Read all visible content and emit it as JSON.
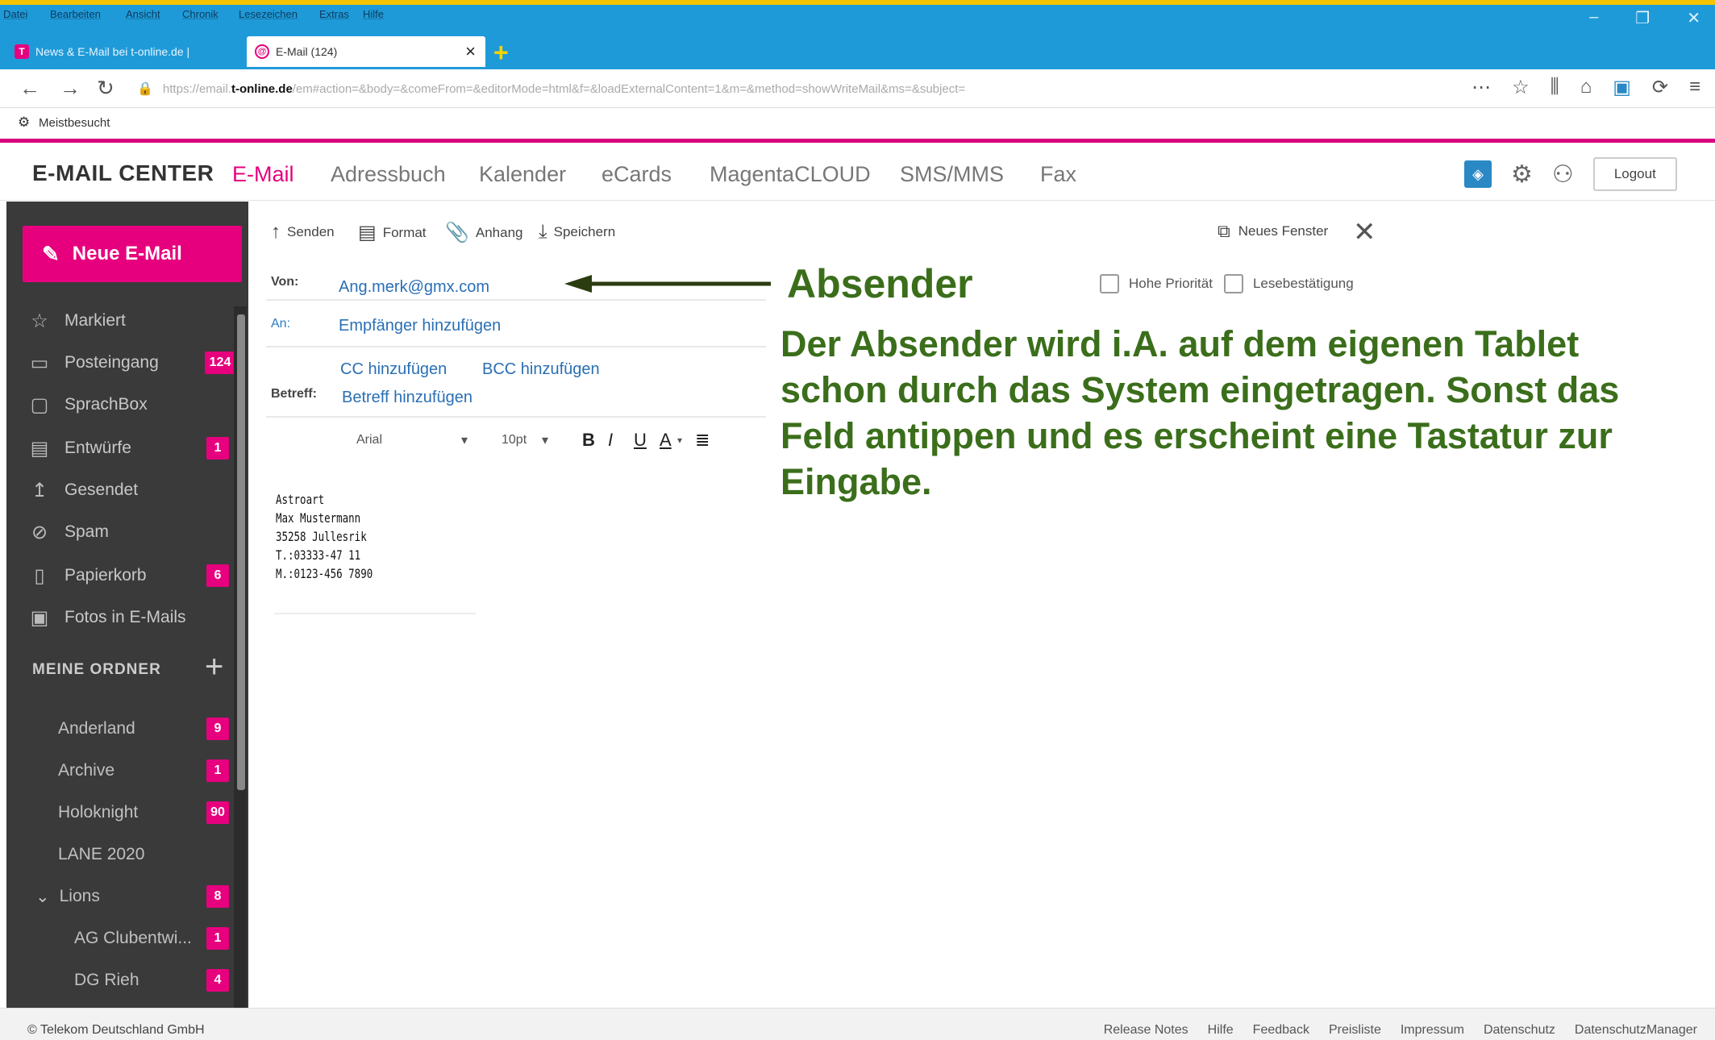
{
  "browser": {
    "menu": [
      "Datei",
      "Bearbeiten",
      "Ansicht",
      "Chronik",
      "Lesezeichen",
      "Extras",
      "Hilfe"
    ],
    "tabs": [
      {
        "title": "News & E-Mail bei t-online.de | ",
        "favicon": "T"
      },
      {
        "title": "E-Mail (124)",
        "favicon": "@"
      }
    ],
    "url_prefix": "https://email.",
    "url_domain": "t-online.de",
    "url_rest": "/em#action=&body=&comeFrom=&editorMode=html&f=&loadExternalContent=1&m=&method=showWriteMail&ms=&subject=",
    "bookmark": "Meistbesucht"
  },
  "app": {
    "brand": "E-MAIL CENTER",
    "nav": [
      "E-Mail",
      "Adressbuch",
      "Kalender",
      "eCards",
      "MagentaCLOUD",
      "SMS/MMS",
      "Fax"
    ],
    "logout": "Logout",
    "accent": "#e6007e"
  },
  "sidebar": {
    "new_mail": "Neue E-Mail",
    "items": [
      {
        "label": "Markiert",
        "icon": "star-icon",
        "badge": ""
      },
      {
        "label": "Posteingang",
        "icon": "inbox-icon",
        "badge": "124"
      },
      {
        "label": "SprachBox",
        "icon": "voicebox-icon",
        "badge": ""
      },
      {
        "label": "Entwürfe",
        "icon": "draft-icon",
        "badge": "1"
      },
      {
        "label": "Gesendet",
        "icon": "sent-icon",
        "badge": ""
      },
      {
        "label": "Spam",
        "icon": "spam-icon",
        "badge": ""
      },
      {
        "label": "Papierkorb",
        "icon": "trash-icon",
        "badge": "6"
      },
      {
        "label": "Fotos in E-Mails",
        "icon": "photo-icon",
        "badge": ""
      }
    ],
    "folders_title": "MEINE ORDNER",
    "folders": [
      {
        "label": "Anderland",
        "badge": "9"
      },
      {
        "label": "Archive",
        "badge": "1"
      },
      {
        "label": "Holoknight",
        "badge": "90"
      },
      {
        "label": "LANE 2020",
        "badge": ""
      },
      {
        "label": "Lions",
        "badge": "8"
      },
      {
        "label": "AG Clubentwi...",
        "badge": "1"
      },
      {
        "label": "DG Rieh",
        "badge": "4"
      }
    ]
  },
  "compose": {
    "toolbar": {
      "send": "Senden",
      "format": "Format",
      "attach": "Anhang",
      "save": "Speichern",
      "new_window": "Neues Fenster"
    },
    "from_label": "Von:",
    "from_value": "Ang.merk@gmx.com",
    "to_label": "An:",
    "to_placeholder": "Empfänger hinzufügen",
    "cc": "CC hinzufügen",
    "bcc": "BCC hinzufügen",
    "subject_label": "Betreff:",
    "subject_placeholder": "Betreff hinzufügen",
    "font": "Arial",
    "size": "10pt",
    "priority": "Hohe Priorität",
    "read_receipt": "Lesebestätigung",
    "signature": [
      "Astroart",
      "Max Mustermann",
      "35258 Jullesrik",
      "T.:03333-47 11",
      "M.:0123-456 7890"
    ]
  },
  "annotation": {
    "title": "Absender",
    "text": "Der Absender wird i.A. auf dem eigenen Tablet schon durch das System eingetragen. Sonst das Feld antippen und es erscheint eine Tastatur zur Eingabe.",
    "color": "#3b6e1b"
  },
  "footer": {
    "copyright": "© Telekom Deutschland GmbH",
    "links": [
      "Release Notes",
      "Hilfe",
      "Feedback",
      "Preisliste",
      "Impressum",
      "Datenschutz",
      "DatenschutzManager"
    ]
  }
}
